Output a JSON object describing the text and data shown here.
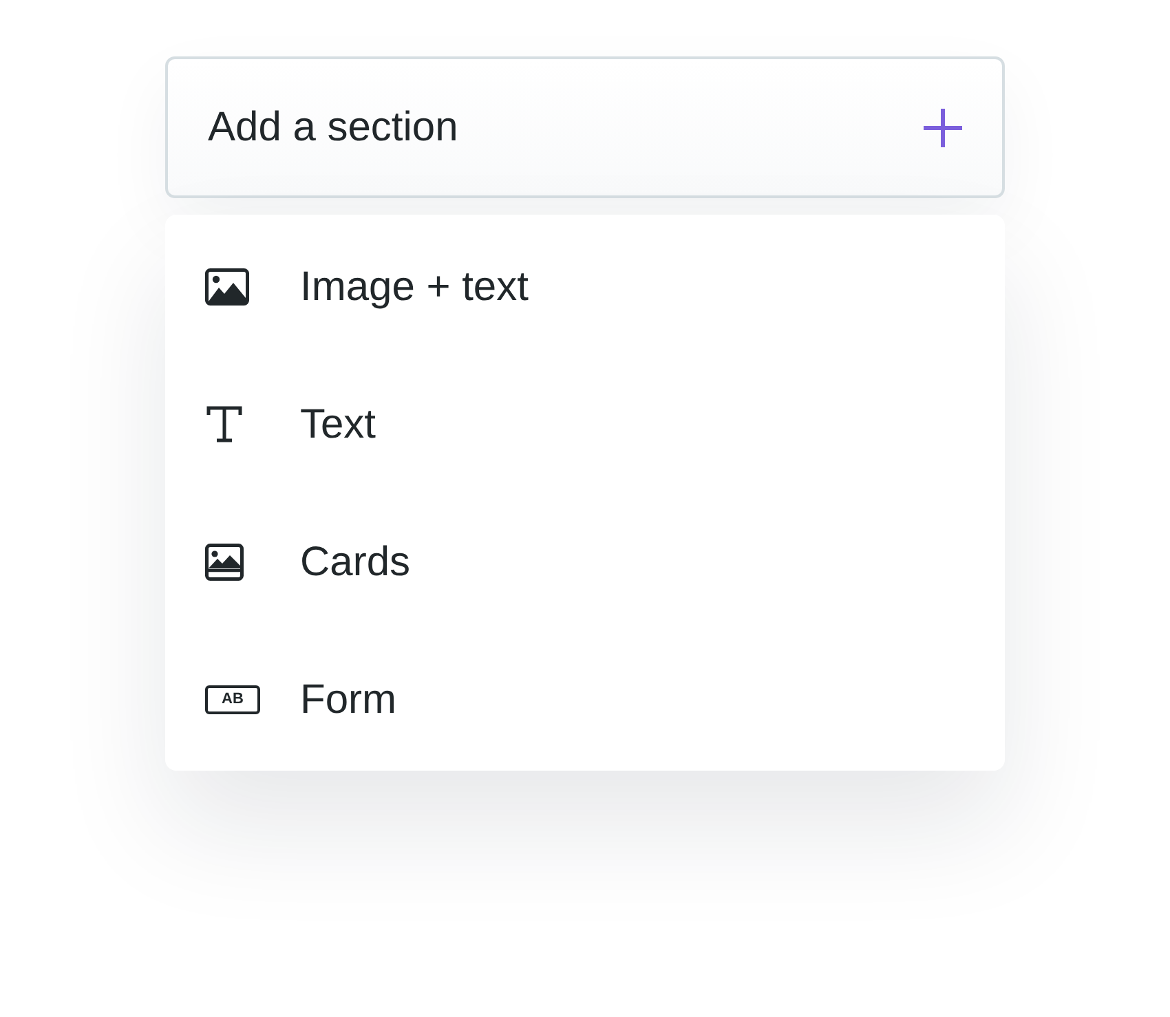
{
  "button": {
    "label": "Add a section"
  },
  "menu": {
    "items": [
      {
        "kind": "image-text",
        "label": "Image + text"
      },
      {
        "kind": "text",
        "label": "Text"
      },
      {
        "kind": "cards",
        "label": "Cards"
      },
      {
        "kind": "form",
        "label": "Form",
        "icon_label": "AB"
      }
    ]
  }
}
